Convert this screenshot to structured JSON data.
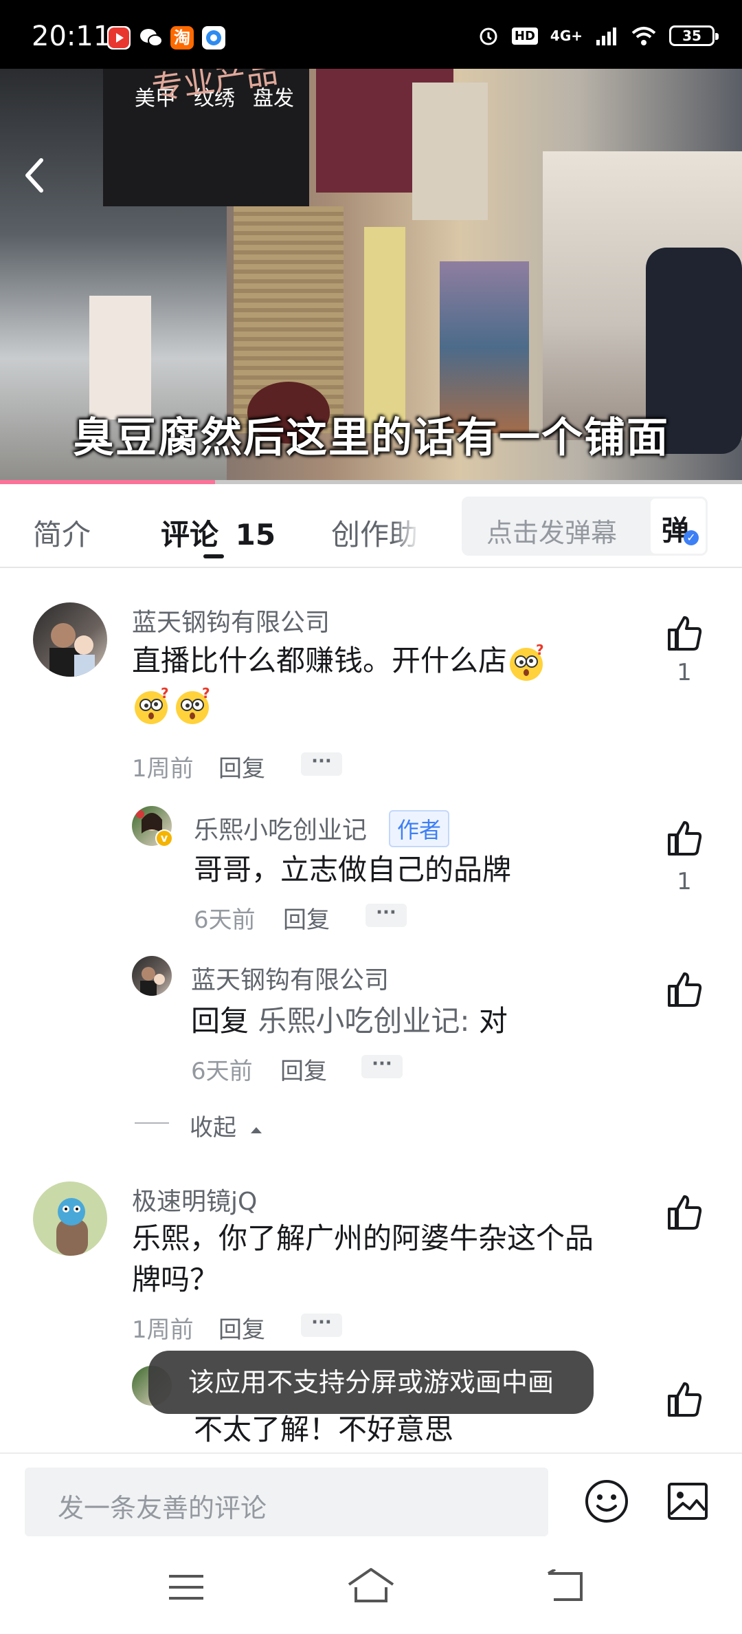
{
  "status_bar": {
    "time": "20:11",
    "battery": "35",
    "network": "4G+",
    "hd": "HD",
    "apps": [
      "video-app-icon",
      "wechat-icon",
      "taobao-icon",
      "browser-icon"
    ],
    "taobao_label": "淘"
  },
  "video": {
    "subtitle": "臭豆腐然后这里的话有一个铺面",
    "progress": 0.29,
    "signs": [
      "美甲",
      "纹绣",
      "盘发",
      "专业产品"
    ]
  },
  "tabs": {
    "intro": "简介",
    "comments": "评论",
    "comments_count": "15",
    "creator": "创作助"
  },
  "danmaku": {
    "placeholder": "点击发弹幕",
    "button": "弹"
  },
  "comments": [
    {
      "user": "蓝天钢钩有限公司",
      "text": "直播比什么都赚钱。开什么店",
      "time": "1周前",
      "reply": "回复",
      "likes": "1",
      "replies": [
        {
          "user": "乐熙小吃创业记",
          "tag": "作者",
          "text": "哥哥，立志做自己的品牌",
          "time": "6天前",
          "reply": "回复",
          "likes": "1"
        },
        {
          "user": "蓝天钢钩有限公司",
          "reply_prefix": "回复",
          "reply_to": "乐熙小吃创业记:",
          "text": "对",
          "time": "6天前",
          "reply": "回复"
        }
      ],
      "collapse": "收起"
    },
    {
      "user": "极速明镜jQ",
      "text_line1": "乐熙，你了解广州的阿婆牛杂这个品",
      "text_line2": "牌吗？",
      "time": "1周前",
      "reply": "回复",
      "replies": [
        {
          "text": "不太了解！不好意思"
        }
      ]
    }
  ],
  "toast": "该应用不支持分屏或游戏画中画",
  "input": {
    "placeholder": "发一条友善的评论"
  },
  "more_label": "···",
  "colors": {
    "accent_pink": "#fb7299",
    "author_blue": "#3d7ff5"
  }
}
